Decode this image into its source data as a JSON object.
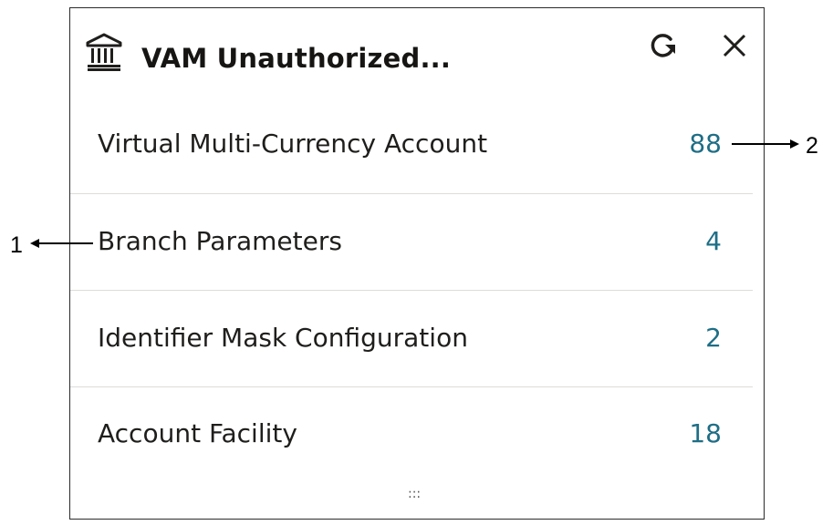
{
  "widget": {
    "title": "VAM Unauthorized...",
    "icons": {
      "header": "bank-icon",
      "refresh": "refresh-icon",
      "close": "close-icon",
      "resize": "drag-grip-icon"
    },
    "accent_color": "#1e6e86",
    "rows": [
      {
        "label": "Virtual Multi-Currency Account",
        "count": "88"
      },
      {
        "label": "Branch Parameters",
        "count": "4"
      },
      {
        "label": "Identifier Mask Configuration",
        "count": "2"
      },
      {
        "label": "Account Facility",
        "count": "18"
      }
    ],
    "grip": ":::"
  },
  "callouts": {
    "left": "1",
    "right": "2"
  }
}
